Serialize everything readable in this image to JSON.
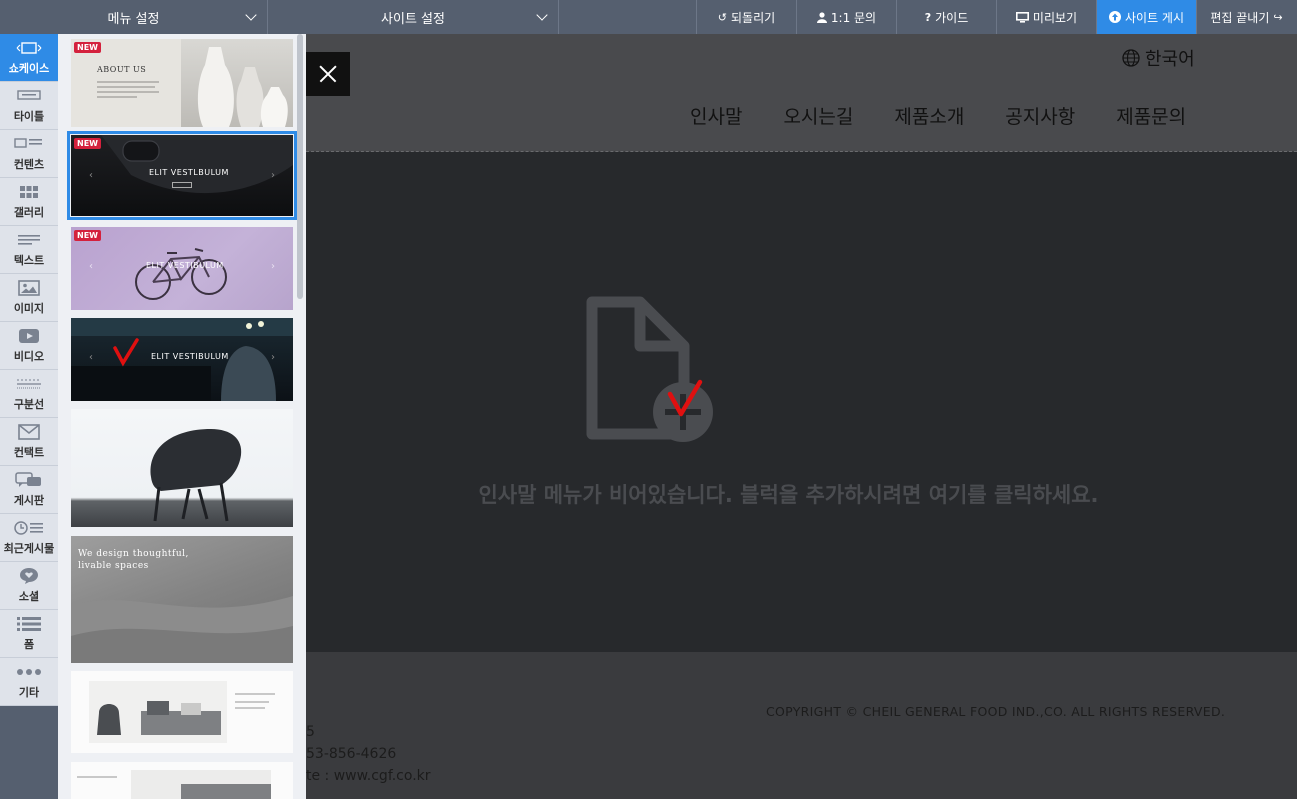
{
  "topbar": {
    "menu_settings": "메뉴 설정",
    "site_settings": "사이트 설정",
    "undo": "되돌리기",
    "inquiry": "1:1 문의",
    "guide": "가이드",
    "preview": "미리보기",
    "publish": "사이트 게시",
    "finish_edit": "편집 끝내기"
  },
  "categories": [
    {
      "label": "쇼케이스",
      "icon": "showcase-icon"
    },
    {
      "label": "타이틀",
      "icon": "title-icon"
    },
    {
      "label": "컨텐츠",
      "icon": "content-icon"
    },
    {
      "label": "갤러리",
      "icon": "gallery-icon"
    },
    {
      "label": "텍스트",
      "icon": "text-icon"
    },
    {
      "label": "이미지",
      "icon": "image-icon"
    },
    {
      "label": "비디오",
      "icon": "video-icon"
    },
    {
      "label": "구분선",
      "icon": "divider-icon"
    },
    {
      "label": "컨택트",
      "icon": "contact-icon"
    },
    {
      "label": "게시판",
      "icon": "board-icon"
    },
    {
      "label": "최근게시물",
      "icon": "recent-posts-icon"
    },
    {
      "label": "소셜",
      "icon": "social-icon"
    },
    {
      "label": "폼",
      "icon": "form-icon"
    },
    {
      "label": "기타",
      "icon": "more-icon"
    }
  ],
  "thumbnails": {
    "badge": "NEW",
    "t1": "ABOUT US",
    "t2": "ELIT VESTLBULUM",
    "t3": "ELIT VESTIBULUM",
    "t4": "ELIT VESTIBULUM",
    "t6_line1": "We design thoughtful,",
    "t6_line2": "livable spaces"
  },
  "site": {
    "language": "한국어",
    "nav": [
      "인사말",
      "오시는길",
      "제품소개",
      "공지사항",
      "제품문의"
    ],
    "empty_message": "인사말 메뉴가 비어있습니다. 블럭을 추가하시려면 여기를 클릭하세요.",
    "copyright": "COPYRIGHT © CHEIL GENERAL FOOD IND.,CO. ALL RIGHTS RESERVED.",
    "footer_line1": "5",
    "footer_line2": "53-856-4626",
    "footer_line3": "te : www.cgf.co.kr"
  },
  "colors": {
    "toolbar": "#555f6f",
    "accent": "#2f8be6",
    "badge": "#d4213d",
    "annotation": "#e01010"
  }
}
